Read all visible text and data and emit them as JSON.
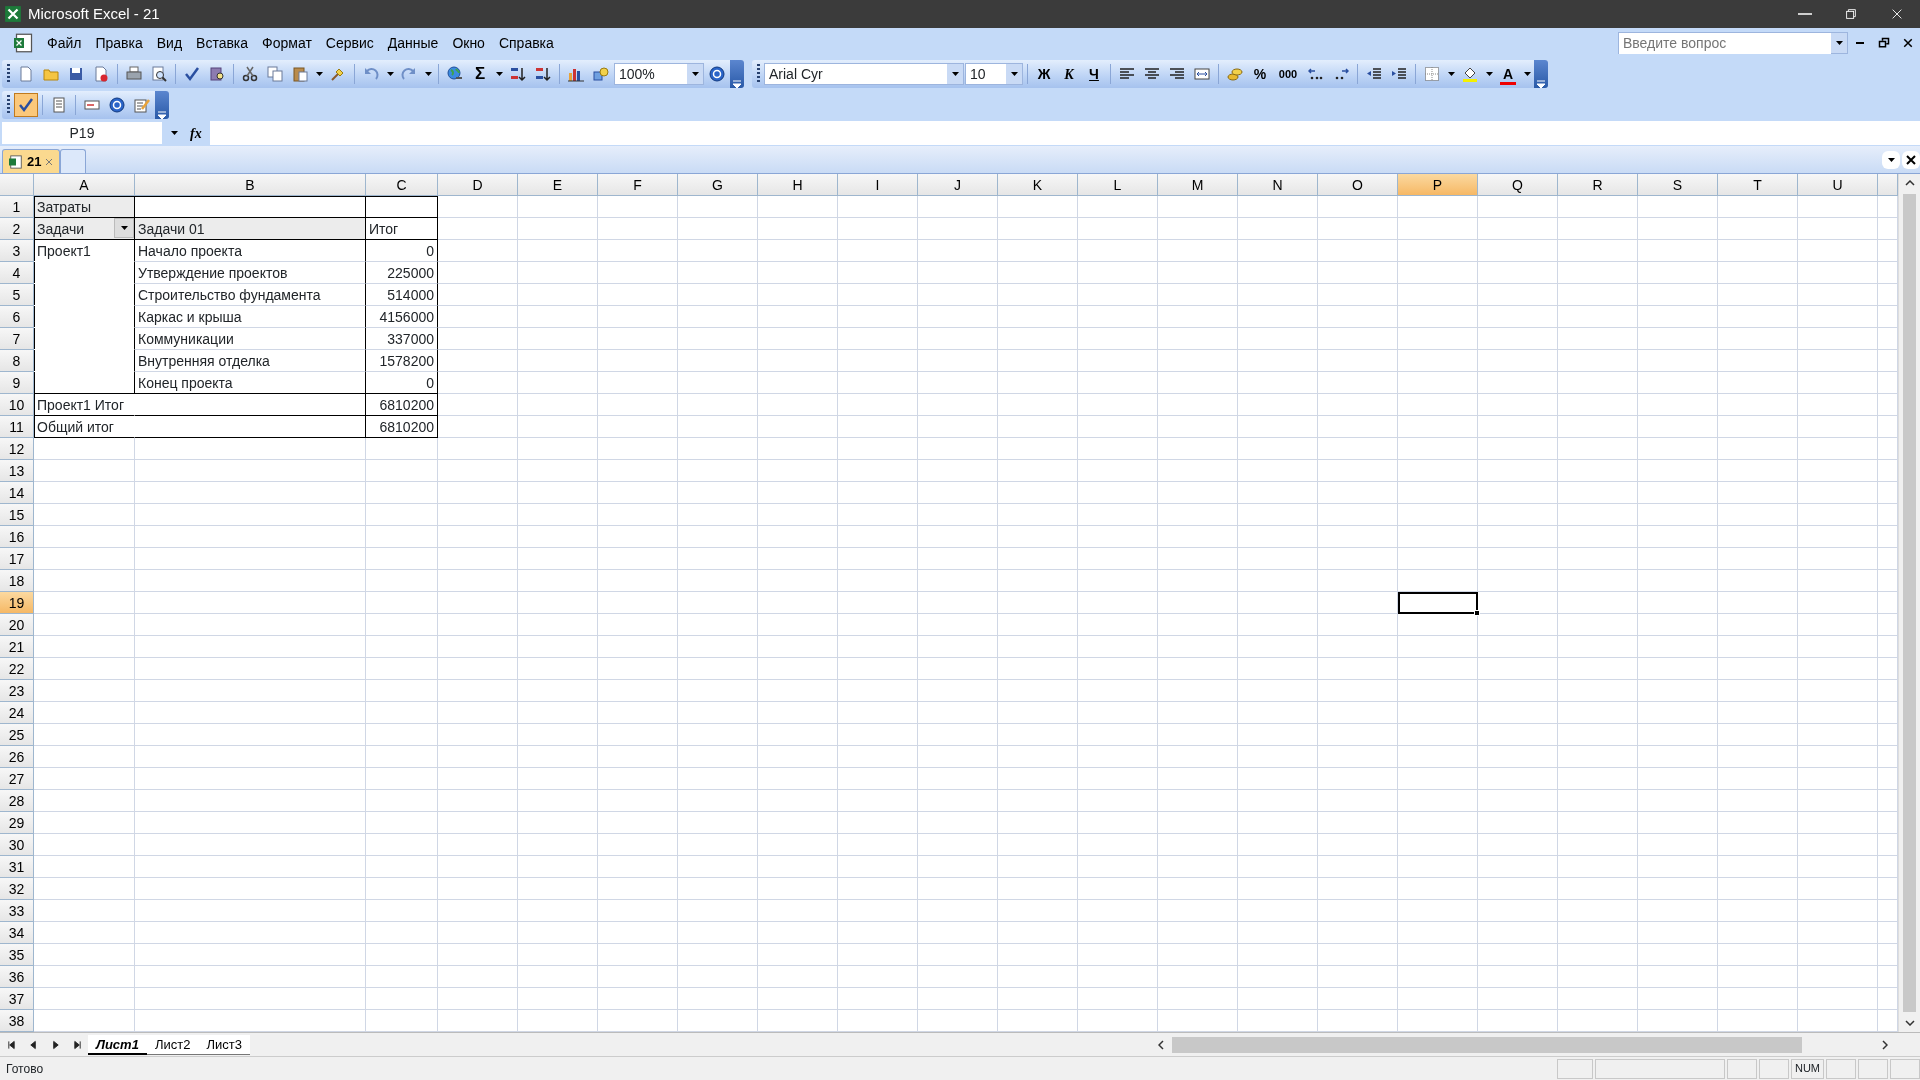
{
  "window": {
    "title": "Microsoft Excel - 21"
  },
  "menu": [
    {
      "label": "Файл"
    },
    {
      "label": "Правка"
    },
    {
      "label": "Вид"
    },
    {
      "label": "Вставка"
    },
    {
      "label": "Формат"
    },
    {
      "label": "Сервис"
    },
    {
      "label": "Данные"
    },
    {
      "label": "Окно"
    },
    {
      "label": "Справка"
    }
  ],
  "help_box": {
    "placeholder": "Введите вопрос"
  },
  "standard_toolbar": {
    "sum": "Σ",
    "zoom": "100%"
  },
  "formatting_toolbar": {
    "font": "Arial Cyr",
    "font_size": "10",
    "bold": "Ж",
    "italic": "К",
    "underline": "Ч",
    "percent": "%",
    "thousands": "000",
    "font_color": "A"
  },
  "task_toolbar": {
    "buttons": [
      {
        "pressed": true
      },
      {
        "pressed": false
      },
      {
        "pressed": false
      },
      {
        "pressed": false
      },
      {
        "pressed": false
      }
    ]
  },
  "formula_bar": {
    "name_box": "P19",
    "function_label": "fx"
  },
  "workbook_tabs": [
    {
      "label": "21",
      "selected": true
    },
    {
      "selected": false
    }
  ],
  "columns": [
    {
      "label": "A",
      "selected": false
    },
    {
      "label": "B",
      "selected": false
    },
    {
      "label": "C",
      "selected": false
    },
    {
      "label": "D",
      "selected": false
    },
    {
      "label": "E",
      "selected": false
    },
    {
      "label": "F",
      "selected": false
    },
    {
      "label": "G",
      "selected": false
    },
    {
      "label": "H",
      "selected": false
    },
    {
      "label": "I",
      "selected": false
    },
    {
      "label": "J",
      "selected": false
    },
    {
      "label": "K",
      "selected": false
    },
    {
      "label": "L",
      "selected": false
    },
    {
      "label": "M",
      "selected": false
    },
    {
      "label": "N",
      "selected": false
    },
    {
      "label": "O",
      "selected": false
    },
    {
      "label": "P",
      "selected": true
    },
    {
      "label": "Q",
      "selected": false
    },
    {
      "label": "R",
      "selected": false
    },
    {
      "label": "S",
      "selected": false
    },
    {
      "label": "T",
      "selected": false
    },
    {
      "label": "U",
      "selected": false
    }
  ],
  "rows": [
    {
      "label": "1",
      "selected": false,
      "cells": {
        "a": {
          "text": "Затраты",
          "kind": "field"
        }
      }
    },
    {
      "label": "2",
      "selected": false,
      "cells": {
        "a": {
          "text": "Задачи",
          "kind": "field-dropdown"
        },
        "b": {
          "text": "Задачи 01",
          "kind": "field"
        },
        "c": {
          "text": "Итог",
          "kind": "text"
        }
      }
    },
    {
      "label": "3",
      "selected": false,
      "cells": {
        "a": {
          "text": "Проект1",
          "kind": "text"
        },
        "b": {
          "text": "Начало проекта",
          "kind": "text"
        },
        "c": {
          "text": "0",
          "kind": "number"
        }
      }
    },
    {
      "label": "4",
      "selected": false,
      "cells": {
        "b": {
          "text": "Утверждение проектов",
          "kind": "text"
        },
        "c": {
          "text": "225000",
          "kind": "number"
        }
      }
    },
    {
      "label": "5",
      "selected": false,
      "cells": {
        "b": {
          "text": "Строительство фундамента",
          "kind": "text"
        },
        "c": {
          "text": "514000",
          "kind": "number"
        }
      }
    },
    {
      "label": "6",
      "selected": false,
      "cells": {
        "b": {
          "text": "Каркас и крыша",
          "kind": "text"
        },
        "c": {
          "text": "4156000",
          "kind": "number"
        }
      }
    },
    {
      "label": "7",
      "selected": false,
      "cells": {
        "b": {
          "text": "Коммуникации",
          "kind": "text"
        },
        "c": {
          "text": "337000",
          "kind": "number"
        }
      }
    },
    {
      "label": "8",
      "selected": false,
      "cells": {
        "b": {
          "text": "Внутренняя отделка",
          "kind": "text"
        },
        "c": {
          "text": "1578200",
          "kind": "number"
        }
      }
    },
    {
      "label": "9",
      "selected": false,
      "cells": {
        "b": {
          "text": "Конец проекта",
          "kind": "text"
        },
        "c": {
          "text": "0",
          "kind": "number"
        }
      }
    },
    {
      "label": "10",
      "selected": false,
      "cells": {
        "a": {
          "text": "Проект1 Итог",
          "kind": "text"
        },
        "c": {
          "text": "6810200",
          "kind": "number"
        }
      }
    },
    {
      "label": "11",
      "selected": false,
      "cells": {
        "a": {
          "text": "Общий итог",
          "kind": "text"
        },
        "c": {
          "text": "6810200",
          "kind": "number"
        }
      }
    },
    {
      "label": "12",
      "selected": false
    },
    {
      "label": "13",
      "selected": false
    },
    {
      "label": "14",
      "selected": false
    },
    {
      "label": "15",
      "selected": false
    },
    {
      "label": "16",
      "selected": false
    },
    {
      "label": "17",
      "selected": false
    },
    {
      "label": "18",
      "selected": false
    },
    {
      "label": "19",
      "selected": true
    },
    {
      "label": "20",
      "selected": false
    },
    {
      "label": "21",
      "selected": false
    },
    {
      "label": "22",
      "selected": false
    },
    {
      "label": "23",
      "selected": false
    },
    {
      "label": "24",
      "selected": false
    },
    {
      "label": "25",
      "selected": false
    },
    {
      "label": "26",
      "selected": false
    },
    {
      "label": "27",
      "selected": false
    },
    {
      "label": "28",
      "selected": false
    },
    {
      "label": "29",
      "selected": false
    },
    {
      "label": "30",
      "selected": false
    },
    {
      "label": "31",
      "selected": false
    },
    {
      "label": "32",
      "selected": false
    },
    {
      "label": "33",
      "selected": false
    },
    {
      "label": "34",
      "selected": false
    },
    {
      "label": "35",
      "selected": false
    },
    {
      "label": "36",
      "selected": false
    },
    {
      "label": "37",
      "selected": false
    },
    {
      "label": "38",
      "selected": false
    }
  ],
  "sheet_tabs": [
    {
      "label": "Лист1",
      "selected": true
    },
    {
      "label": "Лист2",
      "selected": false
    },
    {
      "label": "Лист3",
      "selected": false
    }
  ],
  "status_bar": {
    "text": "Готово",
    "indicators": [
      "NUM"
    ]
  }
}
